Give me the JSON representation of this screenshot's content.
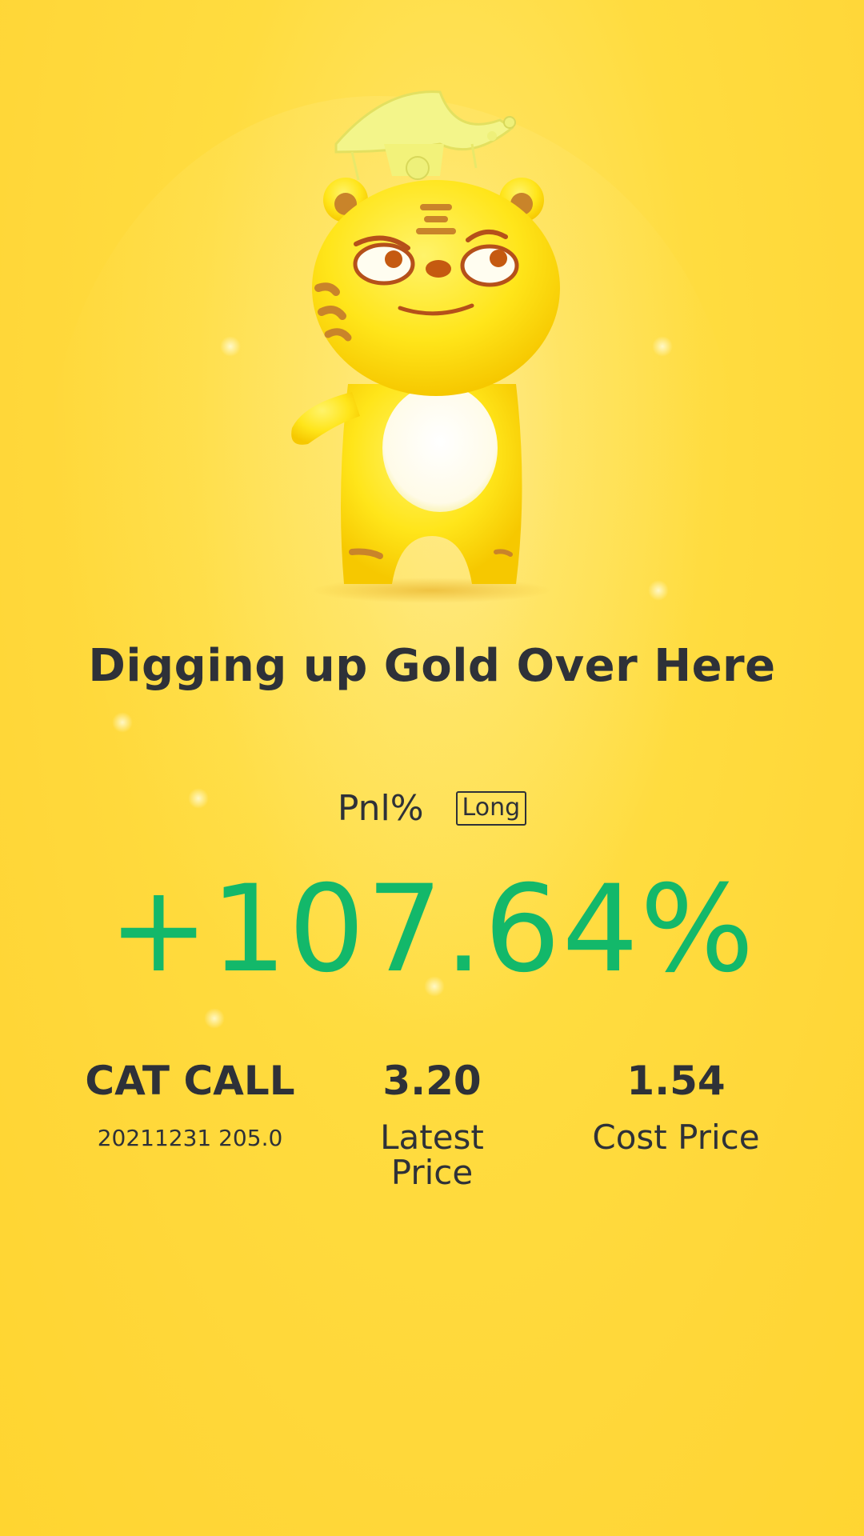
{
  "header": {
    "title": "Digging up Gold Over Here"
  },
  "pnl": {
    "label": "Pnl%",
    "direction": "Long",
    "value": "+107.64%",
    "value_color": "#13b86a"
  },
  "position": {
    "name": "CAT CALL",
    "contract": "20211231 205.0"
  },
  "stats": {
    "latest_price": {
      "value": "3.20",
      "label": "Latest\nPrice"
    },
    "cost_price": {
      "value": "1.54",
      "label": "Cost Price"
    }
  },
  "mascot": {
    "icon": "tiger-mascot-icon"
  },
  "colors": {
    "background": "#ffd83a",
    "text": "#2e3138",
    "gain": "#13b86a"
  }
}
